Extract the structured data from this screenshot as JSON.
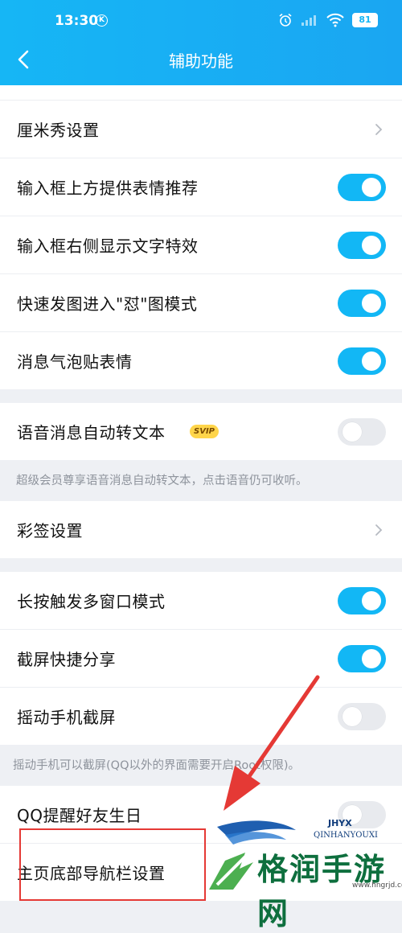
{
  "status": {
    "time": "13:30",
    "k_badge": "K",
    "battery": "81"
  },
  "header": {
    "title": "辅助功能"
  },
  "groups": {
    "g1": [
      {
        "label": "厘米秀设置",
        "type": "chevron"
      },
      {
        "label": "输入框上方提供表情推荐",
        "type": "toggle",
        "on": true
      },
      {
        "label": "输入框右侧显示文字特效",
        "type": "toggle",
        "on": true
      },
      {
        "label": "快速发图进入\"怼\"图模式",
        "type": "toggle",
        "on": true
      },
      {
        "label": "消息气泡贴表情",
        "type": "toggle",
        "on": true
      }
    ],
    "g2": [
      {
        "label": "语音消息自动转文本",
        "badge": "SVIP",
        "type": "toggle",
        "on": false
      }
    ],
    "g2_note": "超级会员尊享语音消息自动转文本，点击语音仍可收听。",
    "g3": [
      {
        "label": "彩签设置",
        "type": "chevron"
      }
    ],
    "g4": [
      {
        "label": "长按触发多窗口模式",
        "type": "toggle",
        "on": true
      },
      {
        "label": "截屏快捷分享",
        "type": "toggle",
        "on": true
      },
      {
        "label": "摇动手机截屏",
        "type": "toggle",
        "on": false
      }
    ],
    "g4_note": "摇动手机可以截屏(QQ以外的界面需要开启Root权限)。",
    "g5": [
      {
        "label": "QQ提醒好友生日",
        "type": "toggle",
        "on": false
      },
      {
        "label": "主页底部导航栏设置",
        "type": "chevron"
      }
    ]
  },
  "watermark": {
    "name": "格润手游网",
    "sub1": "JHYX",
    "sub2": "QINHANYOUXI",
    "url": "www.hngrjd.com"
  },
  "colors": {
    "accent": "#12b7f5",
    "annotation": "#e53935",
    "svip": "#ffd54a"
  },
  "icons": {
    "back": "chevron-left-icon",
    "chevron": "chevron-right-icon"
  }
}
